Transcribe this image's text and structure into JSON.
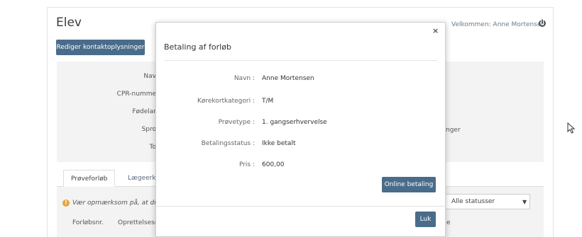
{
  "page": {
    "title": "Elev",
    "welcome": "Velkommen: Anne Mortensen",
    "edit_button": "Rediger kontaktoplysninger"
  },
  "info": {
    "labels": [
      "Nav",
      "CPR-numme",
      "Fødelar",
      "Spro",
      "To"
    ],
    "right_value": "nger"
  },
  "tabs": [
    {
      "label": "Prøveforløb",
      "active": true
    },
    {
      "label": "Lægeerklærin",
      "active": false
    }
  ],
  "list": {
    "warning": "Vær opmærksom på, at du s",
    "status_filter": "Alle statusser",
    "columns": [
      "Forløbsnr.",
      "Oprettelsesdat",
      "e"
    ]
  },
  "modal": {
    "title": "Betaling af forløb",
    "close_icon": "×",
    "rows": [
      {
        "label": "Navn :",
        "value": "Anne Mortensen"
      },
      {
        "label": "Kørekortkategori :",
        "value": "T/M"
      },
      {
        "label": "Prøvetype :",
        "value": "1. gangserhvervelse"
      },
      {
        "label": "Betalingsstatus :",
        "value": "Ikke betalt"
      },
      {
        "label": "Pris :",
        "value": "600,00"
      }
    ],
    "pay_button": "Online betaling",
    "close_button": "Luk"
  },
  "icons": {
    "power": "power-icon",
    "warning": "info-icon",
    "caret": "chevron-down-icon",
    "cursor": "cursor-icon"
  },
  "colors": {
    "primary": "#4a6c8b",
    "warning": "#e7a23b"
  }
}
